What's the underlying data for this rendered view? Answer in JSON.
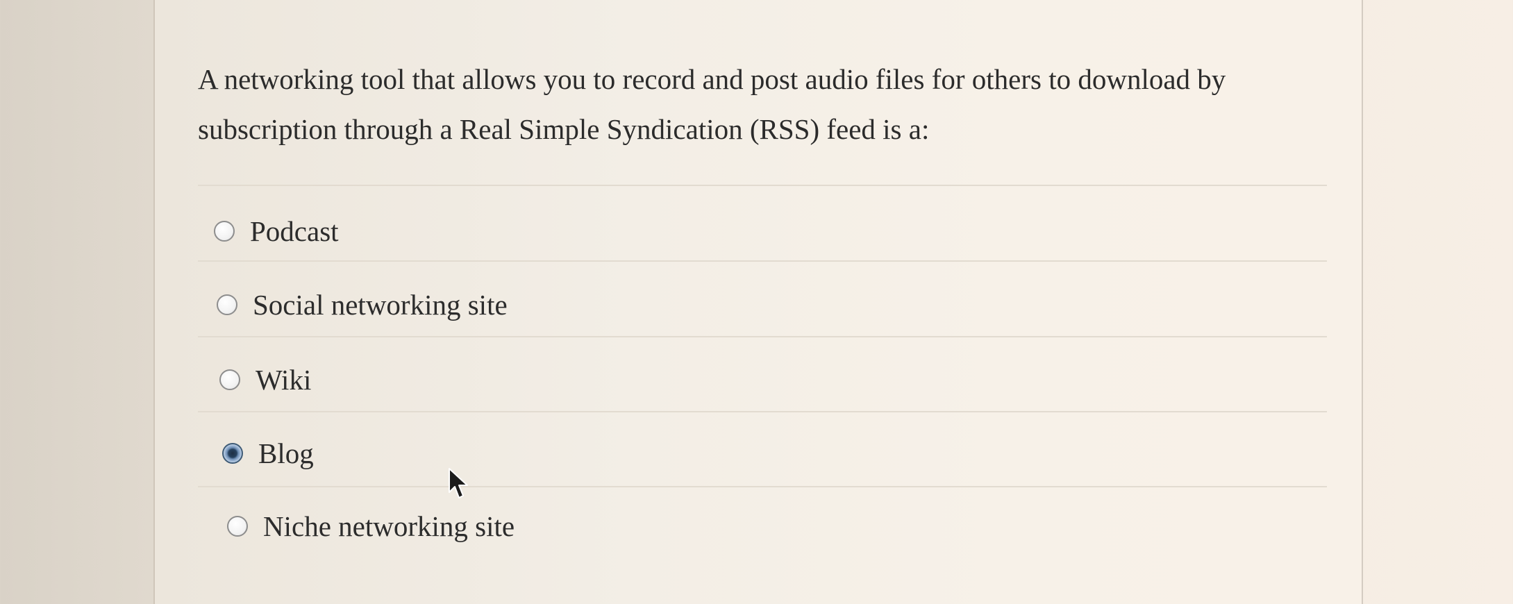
{
  "question": {
    "text": "A networking tool that allows you to record and post audio files for others to download by subscription through a Real Simple Syndication (RSS) feed is a:"
  },
  "options": [
    {
      "label": "Podcast",
      "selected": false
    },
    {
      "label": "Social networking site",
      "selected": false
    },
    {
      "label": "Wiki",
      "selected": false
    },
    {
      "label": "Blog",
      "selected": true
    },
    {
      "label": "Niche networking site",
      "selected": false
    }
  ]
}
